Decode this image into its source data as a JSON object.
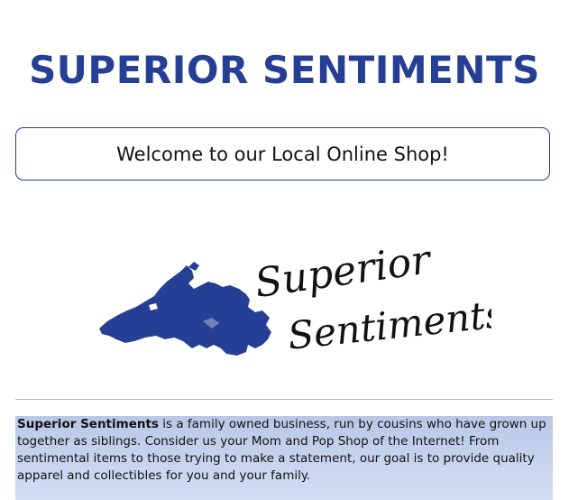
{
  "header": {
    "title": "SUPERIOR SENTIMENTS"
  },
  "welcome": {
    "text": "Welcome to our Local Online Shop!"
  },
  "logo": {
    "line1": "Superior",
    "line2": "Sentiments",
    "map_color": "#243f94",
    "map_icon": "lake-superior-map-icon"
  },
  "about": {
    "brand": "Superior Sentiments",
    "text": " is a family owned business, run by cousins who have grown up together as siblings. Consider us your Mom and Pop Shop of the Internet! From sentimental items to those trying to make a statement, our goal is to provide quality apparel and collectibles for you and your family."
  },
  "colors": {
    "brand_blue": "#243f94",
    "about_background": "#c3cfeb"
  }
}
